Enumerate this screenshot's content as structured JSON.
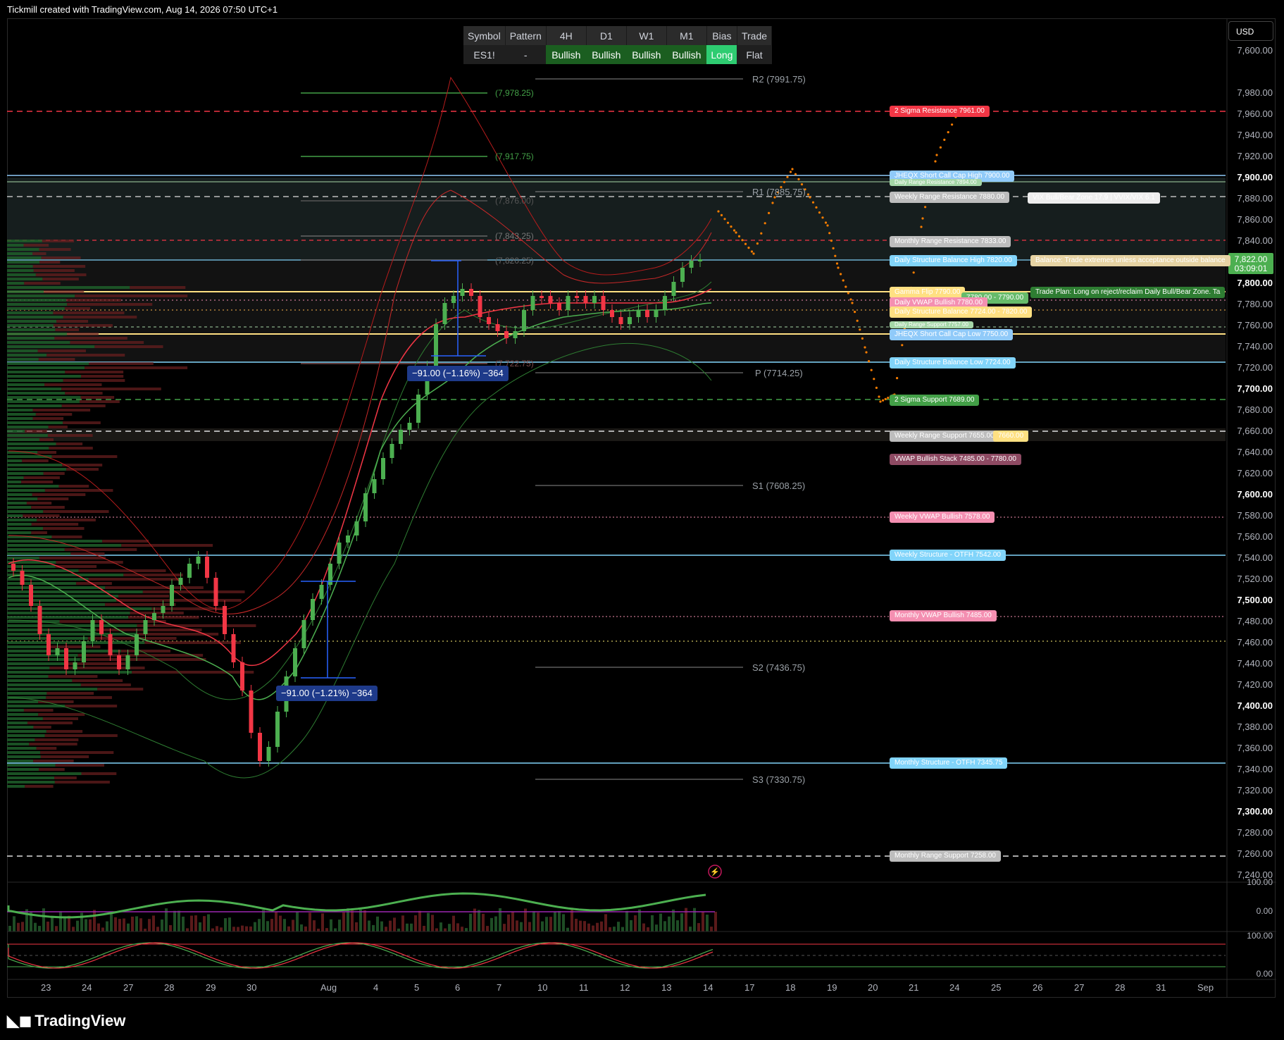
{
  "header": "Tickmill created with TradingView.com, Aug 14, 2026 07:50 UTC+1",
  "currency": "USD",
  "logo": "TradingView",
  "info_table": {
    "headers": [
      "Symbol",
      "Pattern",
      "4H",
      "D1",
      "W1",
      "M1",
      "Bias",
      "Trade"
    ],
    "values": [
      "ES1!",
      "-",
      "Bullish",
      "Bullish",
      "Bullish",
      "Bullish",
      "Long",
      "Flat"
    ]
  },
  "current_price": {
    "value": "7,822.00",
    "countdown": "03:09:01"
  },
  "price_axis": [
    {
      "label": "7,600.00",
      "bold": false
    },
    {
      "label": "7,980.00",
      "bold": false
    },
    {
      "label": "7,960.00",
      "bold": false
    },
    {
      "label": "7,940.00",
      "bold": false
    },
    {
      "label": "7,920.00",
      "bold": false
    },
    {
      "label": "7,900.00",
      "bold": true
    },
    {
      "label": "7,880.00",
      "bold": false
    },
    {
      "label": "7,860.00",
      "bold": false
    },
    {
      "label": "7,840.00",
      "bold": false
    },
    {
      "label": "7,800.00",
      "bold": true
    },
    {
      "label": "7,780.00",
      "bold": false
    },
    {
      "label": "7,760.00",
      "bold": false
    },
    {
      "label": "7,740.00",
      "bold": false
    },
    {
      "label": "7,720.00",
      "bold": false
    },
    {
      "label": "7,700.00",
      "bold": true
    },
    {
      "label": "7,680.00",
      "bold": false
    },
    {
      "label": "7,660.00",
      "bold": false
    },
    {
      "label": "7,640.00",
      "bold": false
    },
    {
      "label": "7,620.00",
      "bold": false
    },
    {
      "label": "7,600.00",
      "bold": true
    },
    {
      "label": "7,580.00",
      "bold": false
    },
    {
      "label": "7,560.00",
      "bold": false
    },
    {
      "label": "7,540.00",
      "bold": false
    },
    {
      "label": "7,520.00",
      "bold": false
    },
    {
      "label": "7,500.00",
      "bold": true
    },
    {
      "label": "7,480.00",
      "bold": false
    },
    {
      "label": "7,460.00",
      "bold": false
    },
    {
      "label": "7,440.00",
      "bold": false
    },
    {
      "label": "7,420.00",
      "bold": false
    },
    {
      "label": "7,400.00",
      "bold": true
    },
    {
      "label": "7,380.00",
      "bold": false
    },
    {
      "label": "7,360.00",
      "bold": false
    },
    {
      "label": "7,340.00",
      "bold": false
    },
    {
      "label": "7,320.00",
      "bold": false
    },
    {
      "label": "7,300.00",
      "bold": true
    },
    {
      "label": "7,280.00",
      "bold": false
    },
    {
      "label": "7,260.00",
      "bold": false
    },
    {
      "label": "7,240.00",
      "bold": false
    }
  ],
  "oscillator_axis": [
    "100.00",
    "0.00",
    "100.00",
    "0.00"
  ],
  "date_axis": [
    "23",
    "24",
    "27",
    "28",
    "29",
    "30",
    "Aug",
    "4",
    "5",
    "6",
    "7",
    "10",
    "11",
    "12",
    "13",
    "14",
    "17",
    "18",
    "19",
    "20",
    "21",
    "24",
    "25",
    "26",
    "27",
    "28",
    "31",
    "Sep"
  ],
  "pivots": [
    "R2 (7991.75)",
    "R1 (7885.75)",
    "P (7714.25)",
    "S1 (7608.25)",
    "S2 (7436.75)",
    "S3 (7330.75)"
  ],
  "fib_levels": [
    "(7,978.25)",
    "(7,917.75)",
    "(7,876.00)",
    "(7,843.25)",
    "(7,820.25)",
    "(7,722.75)"
  ],
  "measure_labels": [
    "−91.00 (−1.16%) −364",
    "−91.00 (−1.21%) −364"
  ],
  "level_labels": [
    {
      "text": "2 Sigma Resistance  7961.00",
      "color": "#f23645"
    },
    {
      "text": "JHEQX Short Call Cap High  7900.00",
      "color": "#90caf9"
    },
    {
      "text": "Daily Range Resistance  7894.00",
      "color": "#a5d6a7"
    },
    {
      "text": "Weekly Range Resistance  7880.00",
      "color": "#bdbdbd"
    },
    {
      "text": "VIX Bull/Bear Zone 17.9 | VVIX/VIX 6.1",
      "color": "#e0e0e0"
    },
    {
      "text": "Monthly Range Resistance  7833.00",
      "color": "#bdbdbd"
    },
    {
      "text": "Daily Structure Balance High  7820.00",
      "color": "#81d4fa"
    },
    {
      "text": "Balance: Trade extremes unless acceptance outside balance",
      "color": "#e6d3a3"
    },
    {
      "text": "Gamma Flip  7790.00",
      "color": "#ffe082"
    },
    {
      "text": "Trade Plan: Long on reject/reclaim Daily Bull/Bear Zone. Ta",
      "color": "#2e7d32"
    },
    {
      "text": "7780.00 - 7790.00",
      "color": "#66bb6a"
    },
    {
      "text": "Daily VWAP Bullish  7780.00",
      "color": "#f48fb1"
    },
    {
      "text": "Daily Structure Balance  7724.00 - 7820.00",
      "color": "#ffe082"
    },
    {
      "text": "Daily Range Support  7757.00",
      "color": "#a5d6a7"
    },
    {
      "text": "JHEQX Short Call Cap Low  7750.00",
      "color": "#90caf9"
    },
    {
      "text": "Daily Structure Balance Low  7724.00",
      "color": "#81d4fa"
    },
    {
      "text": "2 Sigma Support  7689.00",
      "color": "#43a047"
    },
    {
      "text": "Weekly Range Support  7655.00",
      "color": "#bdbdbd"
    },
    {
      "text": "7660.00",
      "color": "#ffe082"
    },
    {
      "text": "VWAP Bullish Stack  7485.00 - 7780.00",
      "color": "#8e4a63"
    },
    {
      "text": "Weekly VWAP Bullish  7578.00",
      "color": "#f48fb1"
    },
    {
      "text": "Weekly Structure - OTFH  7542.00",
      "color": "#81d4fa"
    },
    {
      "text": "Monthly VWAP Bullish  7485.00",
      "color": "#f48fb1"
    },
    {
      "text": "Monthly Structure - OTFH  7345.75",
      "color": "#81d4fa"
    },
    {
      "text": "Monthly Range Support  7258.00",
      "color": "#bdbdbd"
    }
  ],
  "colors": {
    "bull": "#4caf50",
    "bear": "#f23645",
    "background": "#000000",
    "level_cyan": "#81d4fa",
    "projection": "#f57c00"
  }
}
